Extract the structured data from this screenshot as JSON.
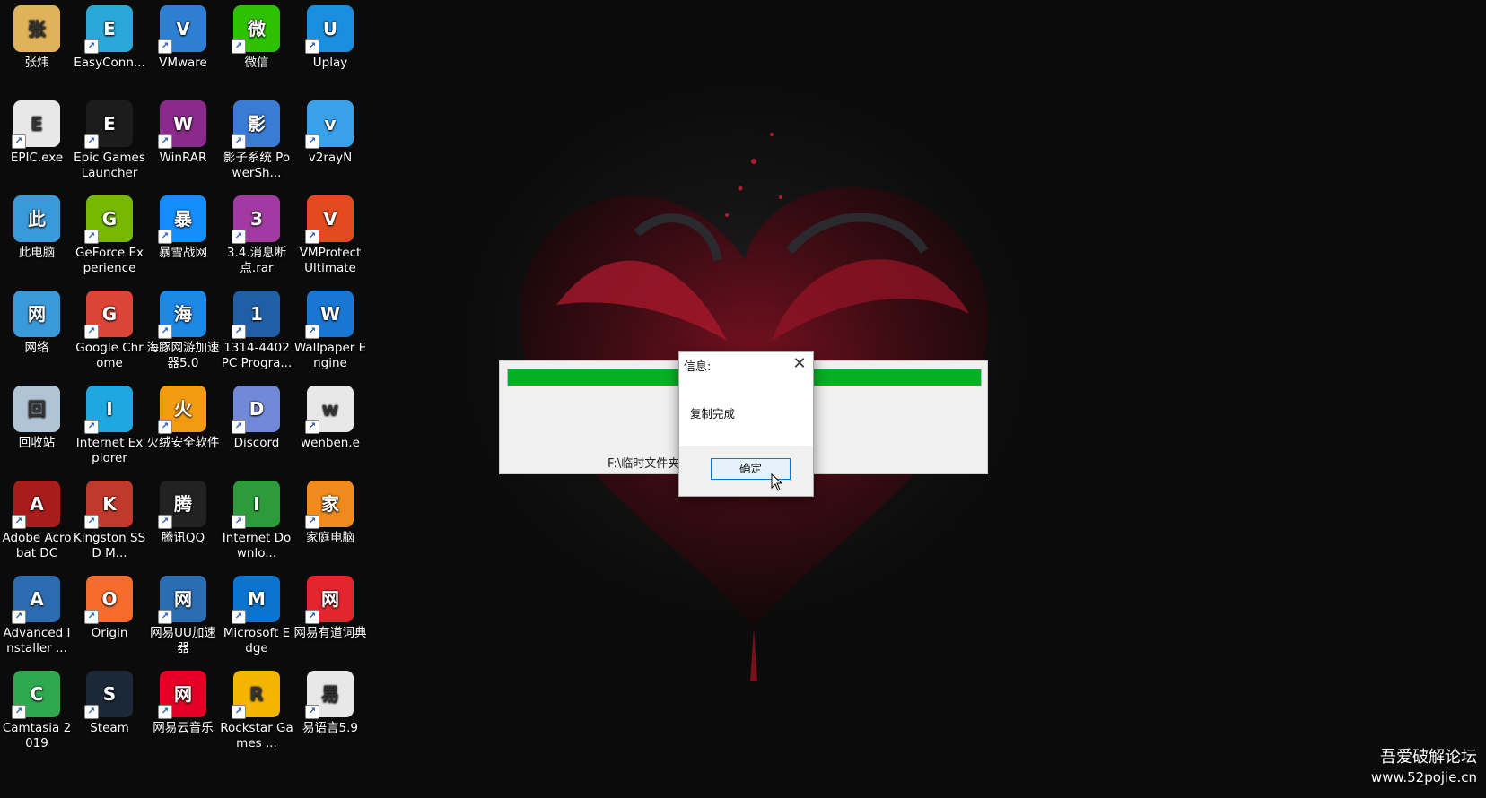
{
  "desktop_icons": [
    {
      "label": "张炜",
      "icon": "user-folder-icon",
      "color": "#e0b35a"
    },
    {
      "label": "EasyConn...",
      "icon": "easyconnect-icon",
      "color": "#2aa7d9"
    },
    {
      "label": "VMware",
      "icon": "vmware-icon",
      "color": "#2e7fd4"
    },
    {
      "label": "微信",
      "icon": "wechat-icon",
      "color": "#2dc100"
    },
    {
      "label": "Uplay",
      "icon": "uplay-icon",
      "color": "#1a8fe0"
    },
    {
      "label": "EPIC.exe",
      "icon": "epic-exe-icon",
      "color": "#e8e8e8"
    },
    {
      "label": "Epic Games Launcher",
      "icon": "epic-games-icon",
      "color": "#1c1c1c"
    },
    {
      "label": "WinRAR",
      "icon": "winrar-icon",
      "color": "#8a2a8a"
    },
    {
      "label": "影子系统 PowerSh...",
      "icon": "shadow-system-icon",
      "color": "#3a7bd5"
    },
    {
      "label": "v2rayN",
      "icon": "v2rayn-icon",
      "color": "#3aa0e8"
    },
    {
      "label": "此电脑",
      "icon": "this-pc-icon",
      "color": "#3a9ad9"
    },
    {
      "label": "GeForce Experience",
      "icon": "geforce-icon",
      "color": "#76b900"
    },
    {
      "label": "暴雪战网",
      "icon": "battlenet-icon",
      "color": "#148eff"
    },
    {
      "label": "3.4.消息断点.rar",
      "icon": "rar-archive-icon",
      "color": "#a33aa3"
    },
    {
      "label": "VMProtect Ultimate",
      "icon": "vmprotect-icon",
      "color": "#e34a1f"
    },
    {
      "label": "网络",
      "icon": "network-icon",
      "color": "#3a9ad9"
    },
    {
      "label": "Google Chrome",
      "icon": "chrome-icon",
      "color": "#db4437"
    },
    {
      "label": "海豚网游加速器5.0",
      "icon": "dolphin-accelerator-icon",
      "color": "#1e88e5"
    },
    {
      "label": "1314-4402 PC Progra...",
      "icon": "pc-program-icon",
      "color": "#1f5fa8"
    },
    {
      "label": "Wallpaper Engine",
      "icon": "wallpaper-engine-icon",
      "color": "#1976d2"
    },
    {
      "label": "回收站",
      "icon": "recycle-bin-icon",
      "color": "#b0c4d6"
    },
    {
      "label": "Internet Explorer",
      "icon": "internet-explorer-icon",
      "color": "#1ea7e1"
    },
    {
      "label": "火绒安全软件",
      "icon": "huorong-icon",
      "color": "#f39c12"
    },
    {
      "label": "Discord",
      "icon": "discord-icon",
      "color": "#7289da"
    },
    {
      "label": "wenben.e",
      "icon": "wenben-file-icon",
      "color": "#e8e8e8"
    },
    {
      "label": "Adobe Acrobat DC",
      "icon": "acrobat-icon",
      "color": "#a81c1c"
    },
    {
      "label": "Kingston SSD M...",
      "icon": "kingston-icon",
      "color": "#c0392b"
    },
    {
      "label": "腾讯QQ",
      "icon": "qq-icon",
      "color": "#222222"
    },
    {
      "label": "Internet Downlo...",
      "icon": "idm-icon",
      "color": "#2e9b3a"
    },
    {
      "label": "家庭电脑",
      "icon": "home-pc-icon",
      "color": "#f18a1c"
    },
    {
      "label": "Advanced Installer ...",
      "icon": "advanced-installer-icon",
      "color": "#2b6cb0"
    },
    {
      "label": "Origin",
      "icon": "origin-icon",
      "color": "#f56c2d"
    },
    {
      "label": "网易UU加速器",
      "icon": "uu-accelerator-icon",
      "color": "#2a6db0"
    },
    {
      "label": "Microsoft Edge",
      "icon": "edge-icon",
      "color": "#0a74d0"
    },
    {
      "label": "网易有道词典",
      "icon": "youdao-icon",
      "color": "#e3262d"
    },
    {
      "label": "Camtasia 2019",
      "icon": "camtasia-icon",
      "color": "#2fa84f"
    },
    {
      "label": "Steam",
      "icon": "steam-icon",
      "color": "#1b2838"
    },
    {
      "label": "网易云音乐",
      "icon": "netease-music-icon",
      "color": "#e60026"
    },
    {
      "label": "Rockstar Games ...",
      "icon": "rockstar-icon",
      "color": "#f5b400"
    },
    {
      "label": "易语言5.9",
      "icon": "eyuyan-icon",
      "color": "#e8e8e8"
    }
  ],
  "progress_window": {
    "progress_fraction": 1.0,
    "path_text": "F:\\临时文件夹",
    "fill_color": "#06b025"
  },
  "message_box": {
    "title": "信息:",
    "close_glyph": "✕",
    "message": "复制完成",
    "ok_label": "确定"
  },
  "watermark": {
    "line1": "吾爱破解论坛",
    "line2": "www.52pojie.cn"
  }
}
